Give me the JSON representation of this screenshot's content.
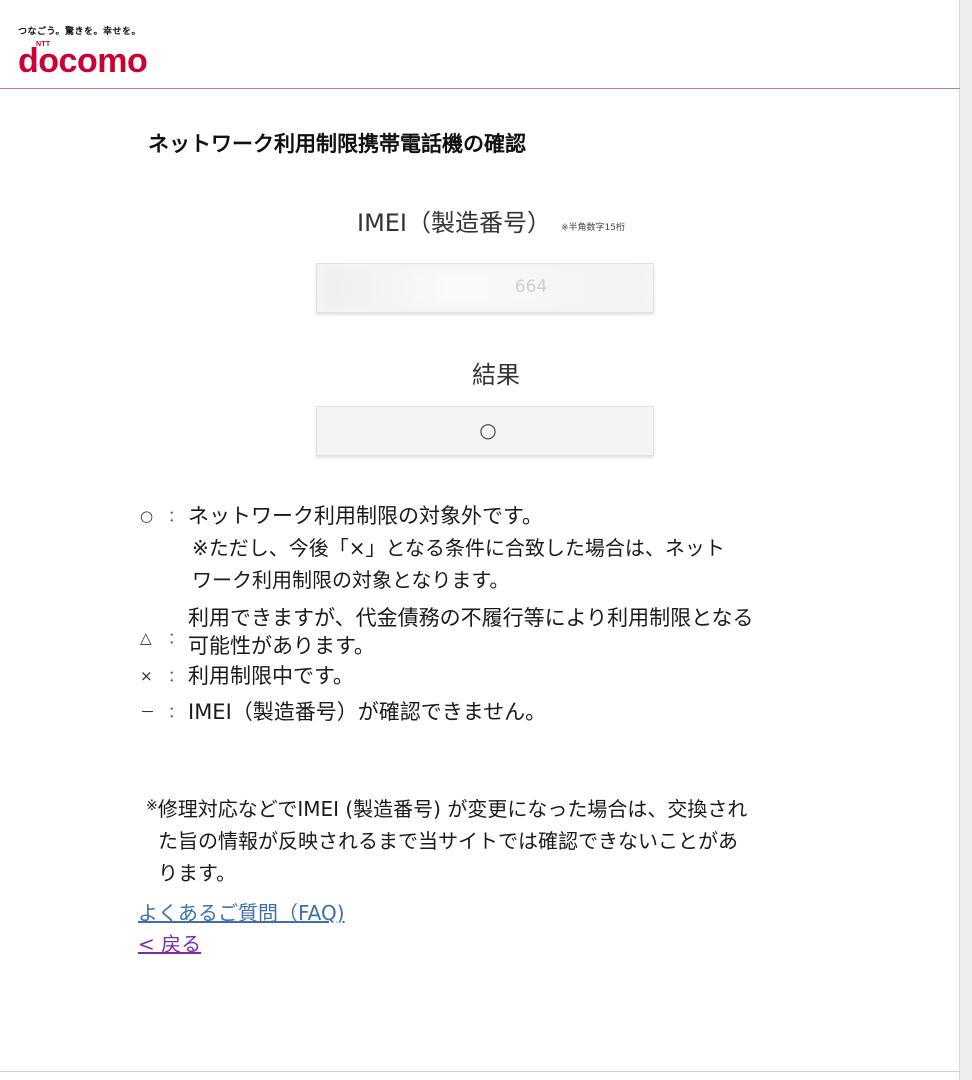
{
  "header": {
    "tagline": "つなごう。驚きを。幸せを。",
    "logo_small": "NTT",
    "logo_text": "docomo",
    "brand_color": "#cc0033"
  },
  "title": "ネットワーク利用制限携帯電話機の確認",
  "imei": {
    "label": "IMEI（製造番号）",
    "note": "※半角数字15桁",
    "value_visible": "664"
  },
  "result": {
    "label": "結果",
    "value": "○"
  },
  "legend": {
    "circle": {
      "symbol": "○",
      "colon": "：",
      "text": "ネットワーク利用制限の対象外です。",
      "sub_line1": "※ただし、今後「×」となる条件に合致した場合は、ネット",
      "sub_line2": "ワーク利用制限の対象となります。"
    },
    "triangle": {
      "symbol": "△",
      "colon": "：",
      "line1": "利用できますが、代金債務の不履行等により利用制限となる",
      "line2": "可能性があります。"
    },
    "cross": {
      "symbol": "×",
      "colon": "：",
      "text": "利用制限中です。"
    },
    "dash": {
      "symbol": "－",
      "colon": "：",
      "text": "IMEI（製造番号）が確認できません。"
    }
  },
  "notice": {
    "mark": "※",
    "line1": "修理対応などでIMEI (製造番号) が変更になった場合は、交換され",
    "line2": "た旨の情報が反映されるまで当サイトでは確認できないことがあ",
    "line3": "ります。"
  },
  "links": {
    "faq": "よくあるご質問（FAQ)",
    "back": "< 戻る"
  }
}
